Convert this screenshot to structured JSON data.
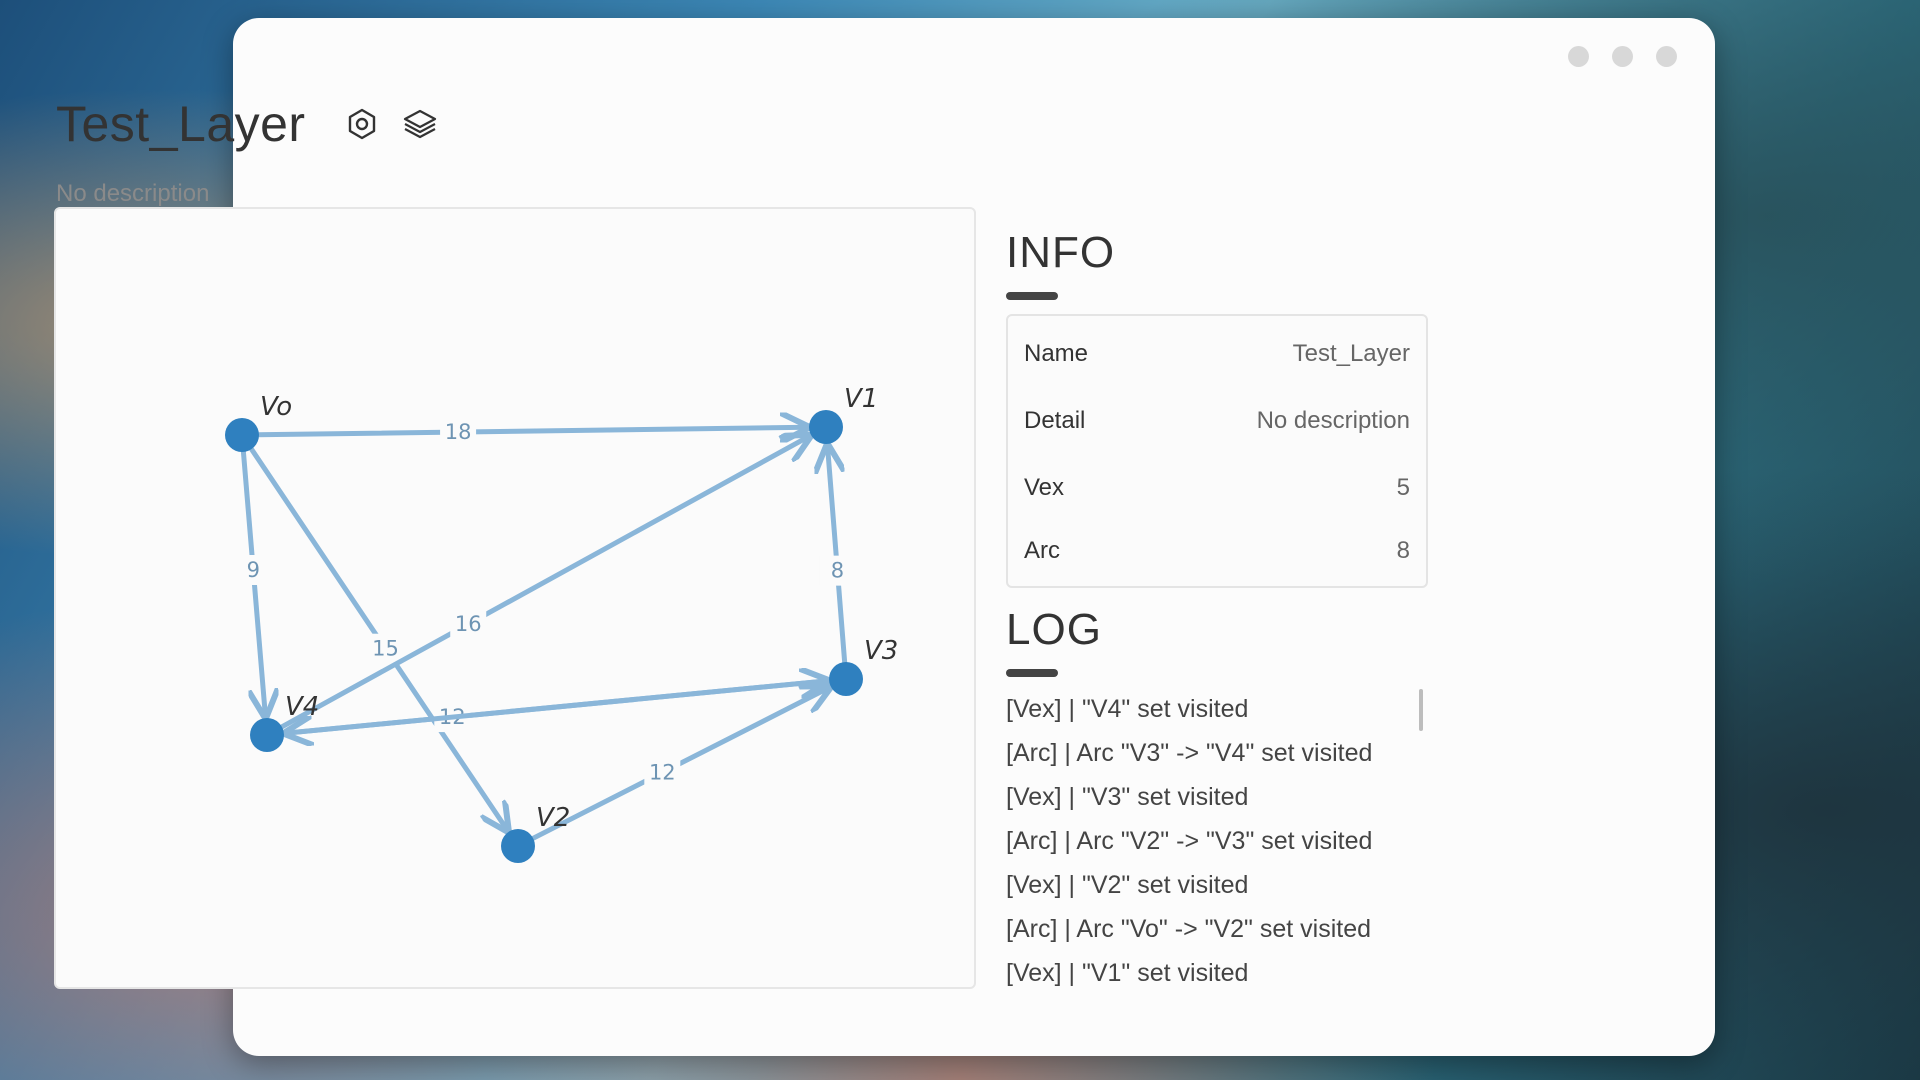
{
  "window": {
    "title": "Test_Layer",
    "description": "No description",
    "icons": [
      "settings-icon",
      "layers-icon"
    ]
  },
  "graph": {
    "nodes": [
      {
        "id": "V0",
        "label": "Vo"
      },
      {
        "id": "V1",
        "label": "V1"
      },
      {
        "id": "V2",
        "label": "V2"
      },
      {
        "id": "V3",
        "label": "V3"
      },
      {
        "id": "V4",
        "label": "V4"
      }
    ],
    "edges": [
      {
        "from": "V0",
        "to": "V1",
        "weight": "18"
      },
      {
        "from": "V0",
        "to": "V4",
        "weight": "9"
      },
      {
        "from": "V0",
        "to": "V2",
        "weight": "15"
      },
      {
        "from": "V4",
        "to": "V1",
        "weight": "16"
      },
      {
        "from": "V3",
        "to": "V1",
        "weight": "8"
      },
      {
        "from": "V3",
        "to": "V4",
        "weight": "12"
      },
      {
        "from": "V4",
        "to": "V3",
        "weight": ""
      },
      {
        "from": "V2",
        "to": "V3",
        "weight": "12"
      }
    ],
    "node_color": "#2f80bf",
    "edge_color": "#8ab6d9"
  },
  "info": {
    "title": "INFO",
    "rows": [
      {
        "key": "Name",
        "value": "Test_Layer"
      },
      {
        "key": "Detail",
        "value": "No description"
      },
      {
        "key": "Vex",
        "value": "5"
      },
      {
        "key": "Arc",
        "value": "8"
      }
    ]
  },
  "log": {
    "title": "LOG",
    "entries": [
      "[Vex] | \"V4\" set visited",
      "[Arc] | Arc \"V3\" -> \"V4\" set visited",
      "[Vex] | \"V3\" set visited",
      "[Arc] | Arc \"V2\" -> \"V3\" set visited",
      "[Vex] | \"V2\" set visited",
      "[Arc] | Arc \"Vo\" -> \"V2\" set visited",
      "[Vex] | \"V1\" set visited"
    ]
  }
}
